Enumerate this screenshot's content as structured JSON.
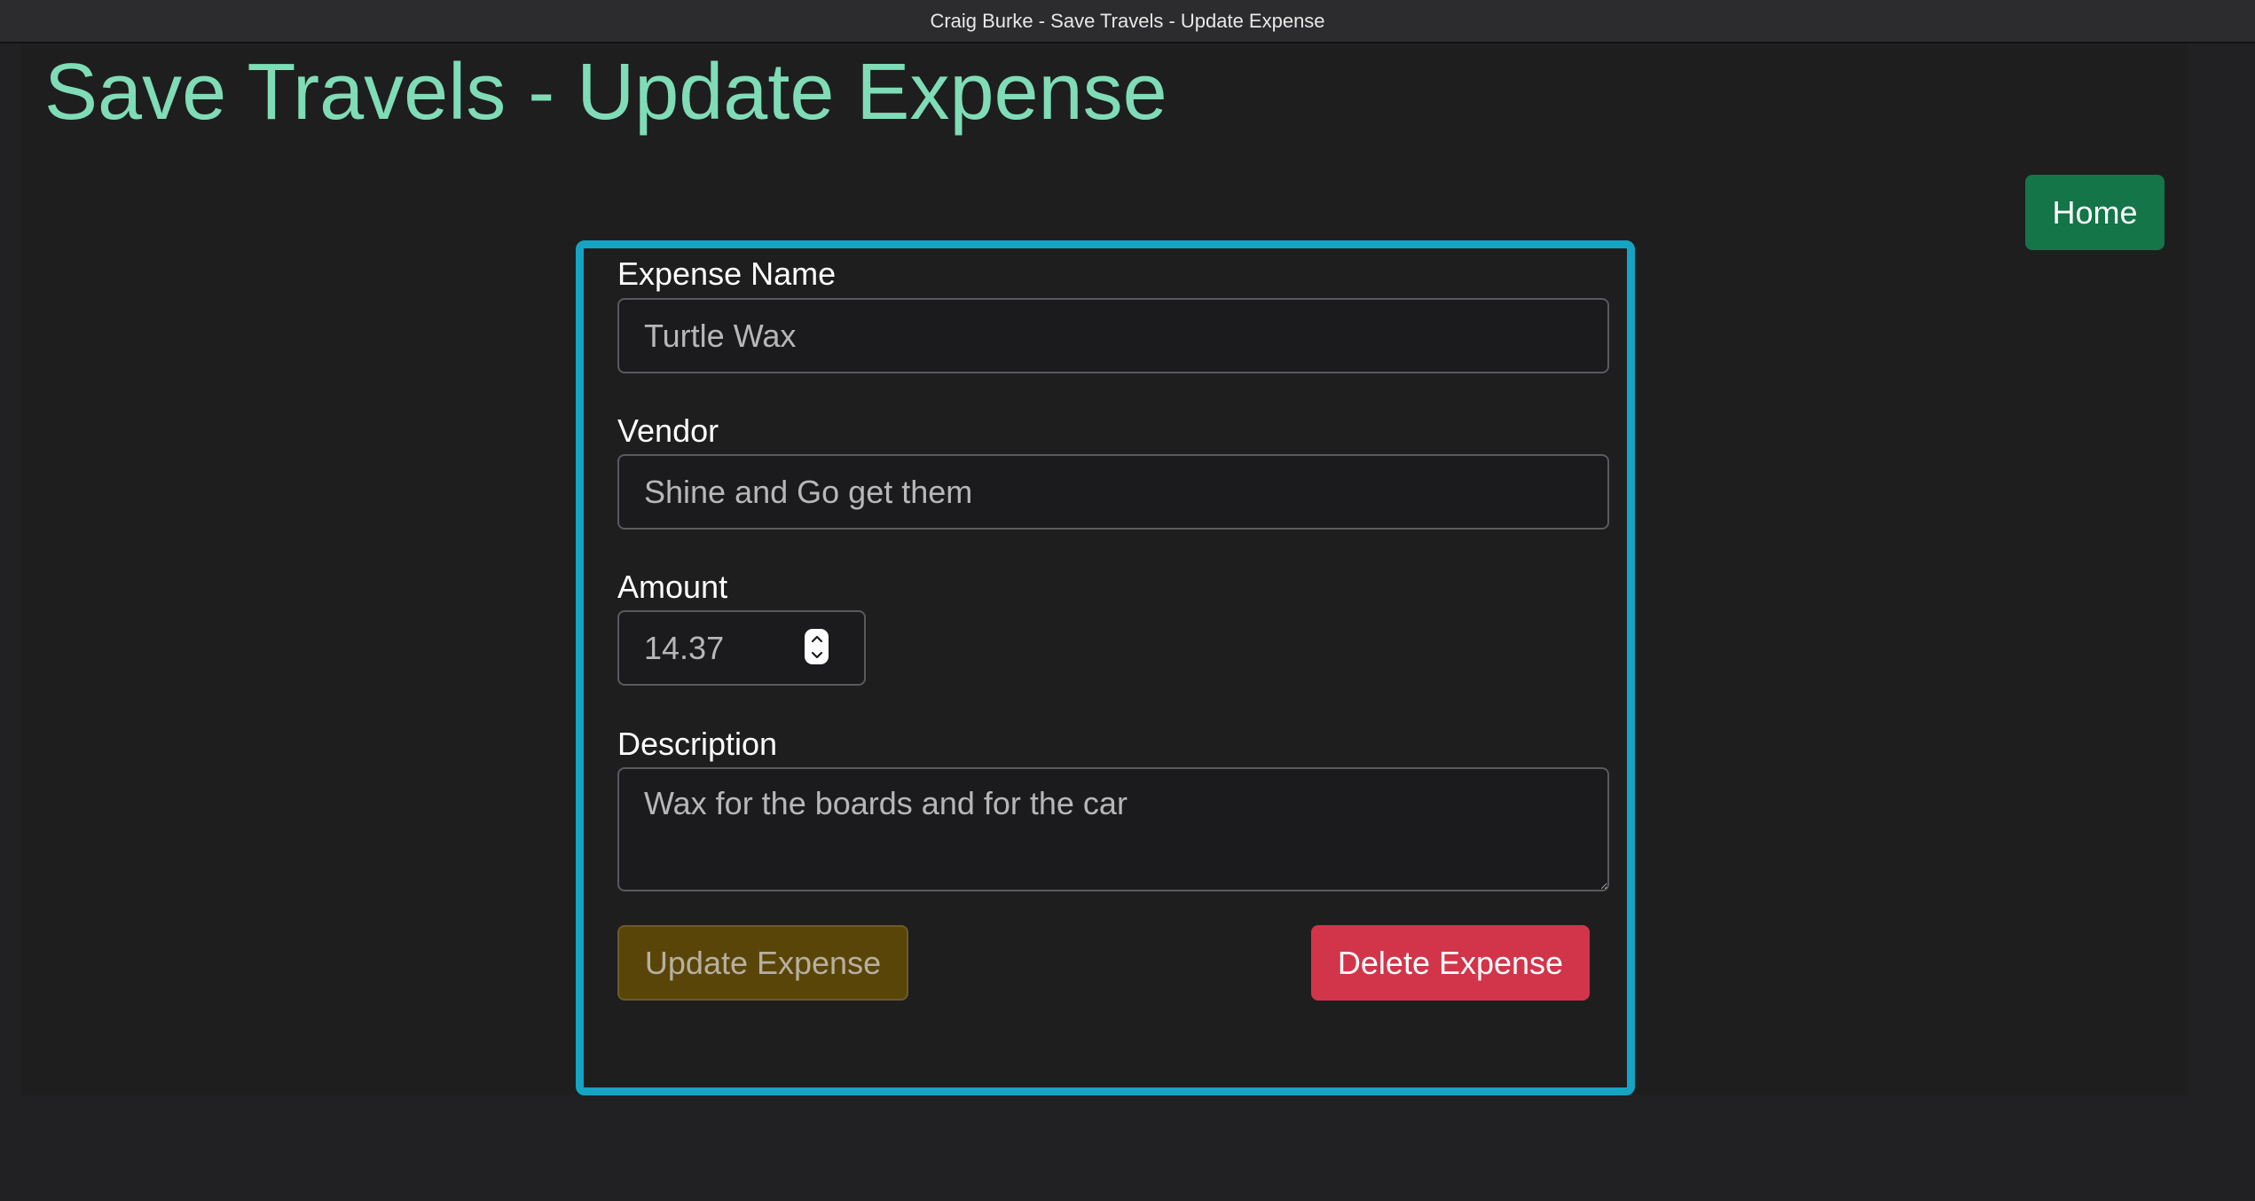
{
  "window": {
    "title": "Craig Burke - Save Travels - Update Expense"
  },
  "header": {
    "title": "Save Travels - Update Expense",
    "title_color": "#7fdcb7"
  },
  "nav": {
    "home_label": "Home",
    "home_color": "#137548"
  },
  "form": {
    "border_color": "#15a4c3",
    "expense_name": {
      "label": "Expense Name",
      "value": "Turtle Wax"
    },
    "vendor": {
      "label": "Vendor",
      "value": "Shine and Go get them"
    },
    "amount": {
      "label": "Amount",
      "value": "14.37"
    },
    "description": {
      "label": "Description",
      "value": "Wax for the boards and for the car"
    },
    "update_label": "Update Expense",
    "update_color": "#5a4509",
    "delete_label": "Delete Expense",
    "delete_color": "#d2354a"
  },
  "icons": {
    "stepper": "stepper-arrows-icon",
    "resize": "resize-grip-icon"
  }
}
